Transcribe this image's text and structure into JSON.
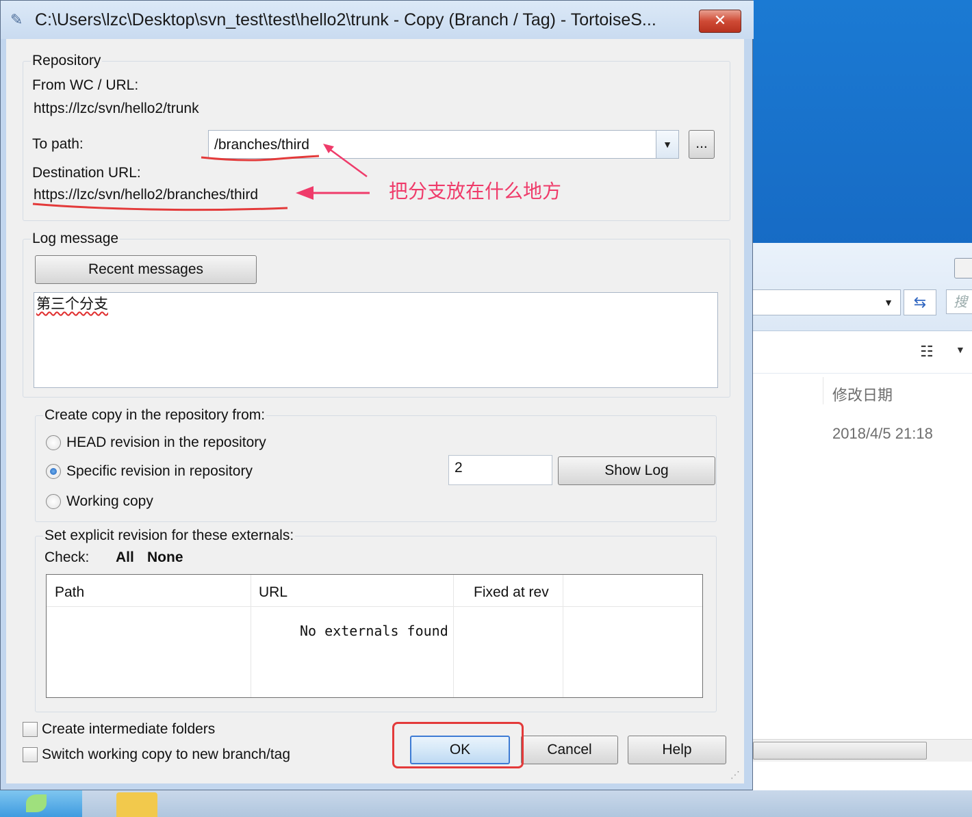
{
  "window": {
    "title": "C:\\Users\\lzc\\Desktop\\svn_test\\test\\hello2\\trunk - Copy (Branch / Tag) - TortoiseS...",
    "close_label": "✕"
  },
  "repository": {
    "group_label": "Repository",
    "from_label": "From WC / URL:",
    "from_url": "https://lzc/svn/hello2/trunk",
    "to_path_label": "To path:",
    "to_path_value": "/branches/third",
    "browse_label": "...",
    "dest_label": "Destination URL:",
    "dest_url": "https://lzc/svn/hello2/branches/third"
  },
  "log": {
    "group_label": "Log message",
    "recent_button": "Recent messages",
    "message": "第三个分支"
  },
  "copy_from": {
    "group_label": "Create copy in the repository from:",
    "options": [
      {
        "label": "HEAD revision in the repository",
        "checked": false
      },
      {
        "label": "Specific revision in repository",
        "checked": true
      },
      {
        "label": "Working copy",
        "checked": false
      }
    ],
    "revision_value": "2",
    "show_log_button": "Show Log"
  },
  "externals": {
    "group_label": "Set explicit revision for these externals:",
    "check_label": "Check:",
    "all_label": "All",
    "none_label": "None",
    "columns": [
      "Path",
      "URL",
      "Fixed at rev"
    ],
    "empty_text": "No externals found"
  },
  "options": {
    "intermediate_label": "Create intermediate folders",
    "switch_label": "Switch working copy to new branch/tag"
  },
  "buttons": {
    "ok": "OK",
    "cancel": "Cancel",
    "help": "Help"
  },
  "annotation": {
    "text": "把分支放在什么地方",
    "color": "#ef3b6a",
    "highlight_color": "#e33a3a"
  },
  "explorer": {
    "column_modified": "修改日期",
    "date_value": "2018/4/5 21:18"
  }
}
